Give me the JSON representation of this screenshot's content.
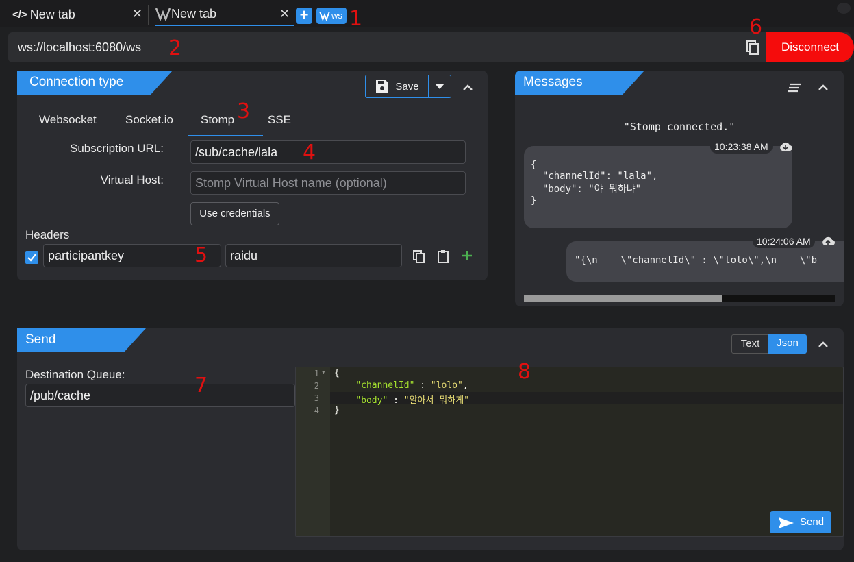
{
  "tabs": [
    {
      "label": "New tab"
    },
    {
      "label": "New tab"
    }
  ],
  "ws_badge": "ws",
  "url": "ws://localhost:6080/ws",
  "disconnect_label": "Disconnect",
  "connection": {
    "title": "Connection type",
    "save_label": "Save",
    "subtabs": [
      "Websocket",
      "Socket.io",
      "Stomp",
      "SSE"
    ],
    "subscription_label": "Subscription URL:",
    "subscription_value": "/sub/cache/lala",
    "vhost_label": "Virtual Host:",
    "vhost_placeholder": "Stomp Virtual Host name (optional)",
    "use_credentials": "Use credentials",
    "headers_label": "Headers",
    "header_key": "participantkey",
    "header_value": "raidu"
  },
  "messages": {
    "title": "Messages",
    "status": "\"Stomp connected.\"",
    "items": [
      {
        "time": "10:23:38 AM",
        "lines": [
          "{",
          "  \"channelId\": \"lala\",",
          "  \"body\": \"야 뭐하냐\"",
          "}"
        ]
      },
      {
        "time": "10:24:06 AM",
        "text": "\"{\\n    \\\"channelId\\\" : \\\"lolo\\\",\\n    \\\"b"
      }
    ]
  },
  "send": {
    "title": "Send",
    "text_label": "Text",
    "json_label": "Json",
    "dest_label": "Destination Queue:",
    "dest_value": "/pub/cache",
    "code_lines": [
      "{",
      "\"channelId\"",
      "\"lolo\"",
      "\"body\"",
      "\"알아서 뭐하게\"",
      "}"
    ],
    "send_label": "Send"
  },
  "annotations": [
    "1",
    "2",
    "3",
    "4",
    "5",
    "6",
    "7",
    "8"
  ],
  "colors": {
    "accent": "#2f8fea",
    "danger": "#f50c0c",
    "bg": "#1f2022",
    "panel": "#2b2c30"
  }
}
